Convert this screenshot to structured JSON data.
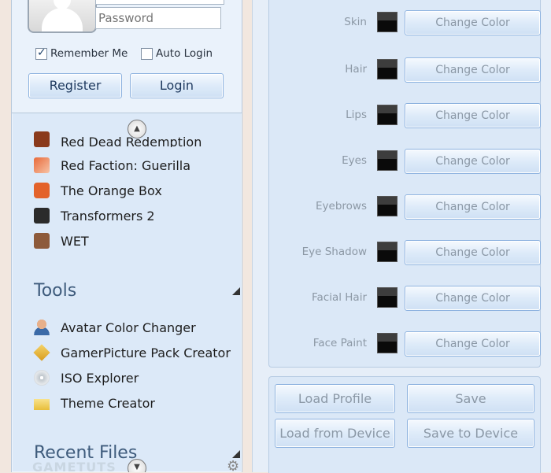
{
  "login": {
    "password_placeholder": "Password",
    "remember_me": "Remember Me",
    "auto_login": "Auto Login",
    "register": "Register",
    "login": "Login"
  },
  "games": {
    "partial_item": "Red Dead Redemption",
    "items": [
      "Red Faction: Guerilla",
      "The Orange Box",
      "Transformers 2",
      "WET"
    ]
  },
  "tools": {
    "title": "Tools",
    "items": [
      "Avatar Color Changer",
      "GamerPicture Pack Creator",
      "ISO Explorer",
      "Theme Creator"
    ]
  },
  "recent": {
    "title": "Recent Files"
  },
  "watermark": "GAMETUTS",
  "colors": {
    "change_label": "Change Color",
    "rows": [
      "Skin",
      "Hair",
      "Lips",
      "Eyes",
      "Eyebrows",
      "Eye Shadow",
      "Facial Hair",
      "Face Paint"
    ]
  },
  "actions": {
    "load_profile": "Load Profile",
    "save": "Save",
    "load_device": "Load from Device",
    "save_device": "Save to Device"
  }
}
